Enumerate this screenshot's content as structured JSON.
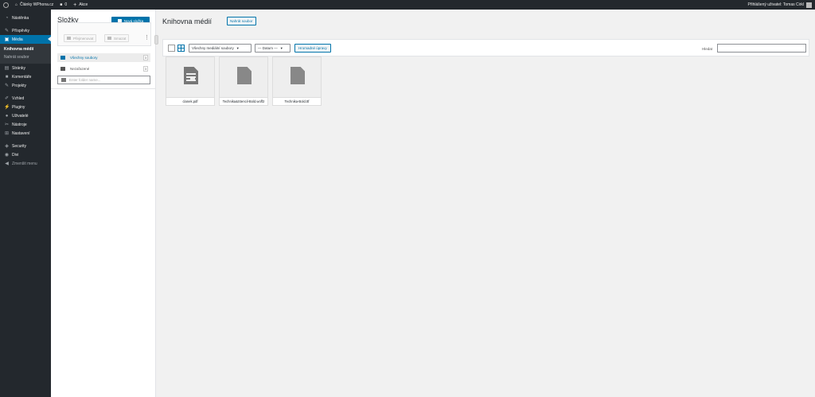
{
  "adminbar": {
    "site_name": "Články WPhona.cz",
    "comments_count": "0",
    "new_label": "Akce",
    "user_greeting": "Přihlášený uživatel: Tomas Cirkl"
  },
  "sidebar": {
    "items": [
      {
        "label": "Nástěnka",
        "icon": "dashboard-icon"
      },
      {
        "label": "Příspěvky",
        "icon": "pin-icon"
      },
      {
        "label": "Média",
        "icon": "media-icon"
      },
      {
        "label": "Stránky",
        "icon": "page-icon"
      },
      {
        "label": "Komentáře",
        "icon": "comment-icon"
      },
      {
        "label": "Projekty",
        "icon": "pin-icon"
      },
      {
        "label": "Vzhled",
        "icon": "brush-icon"
      },
      {
        "label": "Pluginy",
        "icon": "plugin-icon"
      },
      {
        "label": "Uživatelé",
        "icon": "users-icon"
      },
      {
        "label": "Nástroje",
        "icon": "wrench-icon"
      },
      {
        "label": "Nastavení",
        "icon": "settings-icon"
      },
      {
        "label": "Security",
        "icon": "shield-icon"
      },
      {
        "label": "Divi",
        "icon": "divi-icon"
      },
      {
        "label": "Zmenšit menu",
        "icon": "collapse-icon"
      }
    ],
    "submenu": [
      "Knihovna médií",
      "Nahrát soubor"
    ]
  },
  "folders": {
    "title": "Složky",
    "new_folder": "Nová složka",
    "rename": "Přejmenovat",
    "delete": "Smazat",
    "all_files": "Všechny soubory",
    "all_files_count": "3",
    "uncategorized": "Nezařazené",
    "uncategorized_count": "3",
    "input_placeholder": "Enter folder name..."
  },
  "main": {
    "title": "Knihovna médií",
    "upload_button": "Nahrát soubor",
    "filter_type": "Všechny mediální soubory",
    "filter_date": "— Datum —",
    "bulk_button": "Hromadné úpravy",
    "search_label": "Hledat",
    "search_value": "",
    "files": [
      {
        "name": "clanek.pdf",
        "type": "pdf"
      },
      {
        "name": "Technika&Stencil-Bold.woff2",
        "type": "file"
      },
      {
        "name": "Technika-Bold.ttf",
        "type": "file"
      }
    ]
  },
  "colors": {
    "accent": "#0073aa",
    "sidebar_bg": "#23282d",
    "page_bg": "#f1f1f1"
  }
}
